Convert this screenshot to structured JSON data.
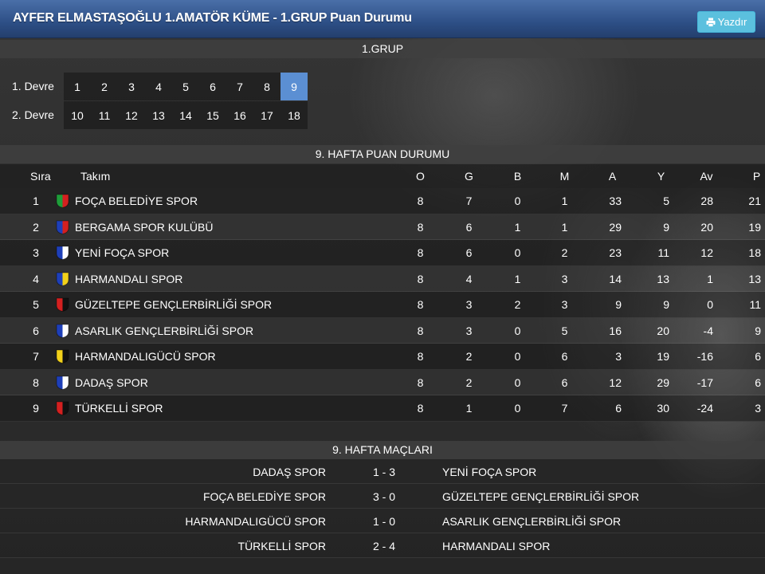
{
  "header": {
    "title": "AYFER ELMASTAŞOĞLU 1.AMATÖR KÜME - 1.GRUP Puan Durumu",
    "print_label": "Yazdır"
  },
  "group": {
    "title": "1.GRUP",
    "first_half_label": "1. Devre",
    "second_half_label": "2. Devre",
    "first_half_weeks": [
      "1",
      "2",
      "3",
      "4",
      "5",
      "6",
      "7",
      "8",
      "9"
    ],
    "second_half_weeks": [
      "10",
      "11",
      "12",
      "13",
      "14",
      "15",
      "16",
      "17",
      "18"
    ],
    "active_week": "9"
  },
  "standings": {
    "title": "9. HAFTA PUAN DURUMU",
    "columns": {
      "rank": "Sıra",
      "team": "Takım",
      "o": "O",
      "g": "G",
      "b": "B",
      "m": "M",
      "a": "A",
      "y": "Y",
      "av": "Av",
      "p": "P"
    },
    "rows": [
      {
        "rank": "1",
        "team": "FOÇA BELEDİYE SPOR",
        "o": "8",
        "g": "7",
        "b": "0",
        "m": "1",
        "a": "33",
        "y": "5",
        "av": "28",
        "p": "21",
        "crest": [
          "#1f9d3a",
          "#d42020"
        ]
      },
      {
        "rank": "2",
        "team": "BERGAMA SPOR KULÜBÜ",
        "o": "8",
        "g": "6",
        "b": "1",
        "m": "1",
        "a": "29",
        "y": "9",
        "av": "20",
        "p": "19",
        "crest": [
          "#1e3fb8",
          "#d42020"
        ]
      },
      {
        "rank": "3",
        "team": "YENİ FOÇA SPOR",
        "o": "8",
        "g": "6",
        "b": "0",
        "m": "2",
        "a": "23",
        "y": "11",
        "av": "12",
        "p": "18",
        "crest": [
          "#1e3fb8",
          "#ffffff"
        ]
      },
      {
        "rank": "4",
        "team": "HARMANDALI SPOR",
        "o": "8",
        "g": "4",
        "b": "1",
        "m": "3",
        "a": "14",
        "y": "13",
        "av": "1",
        "p": "13",
        "crest": [
          "#1e3fb8",
          "#f2d11a"
        ]
      },
      {
        "rank": "5",
        "team": "GÜZELTEPE GENÇLERBİRLİĞİ SPOR",
        "o": "8",
        "g": "3",
        "b": "2",
        "m": "3",
        "a": "9",
        "y": "9",
        "av": "0",
        "p": "11",
        "crest": [
          "#d42020",
          "#111111"
        ]
      },
      {
        "rank": "6",
        "team": "ASARLIK GENÇLERBİRLİĞİ SPOR",
        "o": "8",
        "g": "3",
        "b": "0",
        "m": "5",
        "a": "16",
        "y": "20",
        "av": "-4",
        "p": "9",
        "crest": [
          "#1e3fb8",
          "#ffffff"
        ]
      },
      {
        "rank": "7",
        "team": "HARMANDALIGÜCÜ SPOR",
        "o": "8",
        "g": "2",
        "b": "0",
        "m": "6",
        "a": "3",
        "y": "19",
        "av": "-16",
        "p": "6",
        "crest": [
          "#f2d11a",
          "#111111"
        ]
      },
      {
        "rank": "8",
        "team": "DADAŞ SPOR",
        "o": "8",
        "g": "2",
        "b": "0",
        "m": "6",
        "a": "12",
        "y": "29",
        "av": "-17",
        "p": "6",
        "crest": [
          "#1e3fb8",
          "#ffffff"
        ]
      },
      {
        "rank": "9",
        "team": "TÜRKELLİ SPOR",
        "o": "8",
        "g": "1",
        "b": "0",
        "m": "7",
        "a": "6",
        "y": "30",
        "av": "-24",
        "p": "3",
        "crest": [
          "#d42020",
          "#111111"
        ]
      }
    ]
  },
  "matches": {
    "title": "9. HAFTA MAÇLARI",
    "rows": [
      {
        "home": "DADAŞ SPOR",
        "score": "1 - 3",
        "away": "YENİ FOÇA SPOR"
      },
      {
        "home": "FOÇA BELEDİYE SPOR",
        "score": "3 - 0",
        "away": "GÜZELTEPE GENÇLERBİRLİĞİ SPOR"
      },
      {
        "home": "HARMANDALIGÜCÜ SPOR",
        "score": "1 - 0",
        "away": "ASARLIK GENÇLERBİRLİĞİ SPOR"
      },
      {
        "home": "TÜRKELLİ SPOR",
        "score": "2 - 4",
        "away": "HARMANDALI SPOR"
      }
    ]
  },
  "colors": {
    "header_blue": "#2d4f86",
    "print_button": "#5bc0de",
    "active_week": "#5b8fd3"
  }
}
